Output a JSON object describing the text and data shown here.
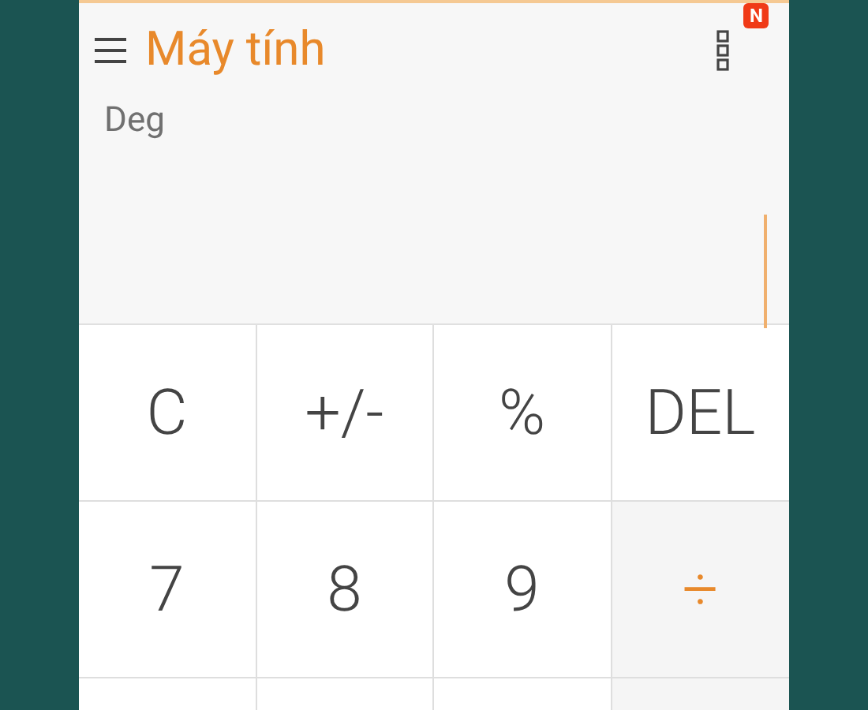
{
  "app_bar": {
    "title": "Máy tính",
    "menu_badge": "N"
  },
  "display": {
    "angle_mode": "Deg"
  },
  "keypad": [
    [
      {
        "label": "C",
        "kind": "function"
      },
      {
        "label": "+/-",
        "kind": "function"
      },
      {
        "label": "%",
        "kind": "function"
      },
      {
        "label": "DEL",
        "kind": "function"
      }
    ],
    [
      {
        "label": "7",
        "kind": "digit"
      },
      {
        "label": "8",
        "kind": "digit"
      },
      {
        "label": "9",
        "kind": "digit"
      },
      {
        "label": "÷",
        "kind": "operator"
      }
    ]
  ]
}
